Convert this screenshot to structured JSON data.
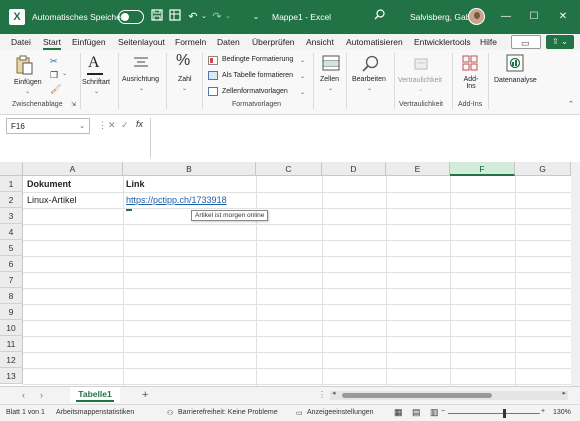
{
  "title_bar": {
    "autosave_label": "Automatisches Speichern",
    "autosave_state": "off",
    "document_title": "Mappe1  -  Excel",
    "user_name": "Salvisberg, Gaby",
    "icons": [
      "save-icon",
      "table-icon",
      "undo-icon",
      "redo-icon",
      "qat-customize-icon",
      "search-icon"
    ],
    "accent_color": "#217346"
  },
  "ribbon_tabs": [
    "Datei",
    "Start",
    "Einfügen",
    "Seitenlayout",
    "Formeln",
    "Daten",
    "Überprüfen",
    "Ansicht",
    "Automatisieren",
    "Entwicklertools",
    "Hilfe"
  ],
  "active_tab": "Start",
  "ribbon": {
    "paste_label": "Einfügen",
    "clipboard_group": "Zwischenablage",
    "font_label": "Schriftart",
    "alignment_label": "Ausrichtung",
    "number_label": "Zahl",
    "percent_symbol": "%",
    "conditional_formatting": "Bedingte Formatierung",
    "format_as_table": "Als Tabelle formatieren",
    "cell_styles": "Zellenformatvorlagen",
    "styles_group": "Formatvorlagen",
    "cells_label": "Zellen",
    "editing_label": "Bearbeiten",
    "sensitivity_label": "Vertraulichkeit",
    "sensitivity_group": "Vertraulichkeit",
    "addins_label": "Add-Ins",
    "addins_group": "Add-Ins",
    "data_analysis_label": "Datenanalyse"
  },
  "formula_bar": {
    "name_box": "F16",
    "fx_label": "fx",
    "formula": ""
  },
  "grid": {
    "columns": [
      "A",
      "B",
      "C",
      "D",
      "E",
      "F",
      "G"
    ],
    "selected_column": "F",
    "rows": [
      "1",
      "2",
      "3",
      "4",
      "5",
      "6",
      "7",
      "8",
      "9",
      "10",
      "11",
      "12",
      "13"
    ],
    "cells": {
      "A1": "Dokument",
      "B1": "Link",
      "A2": "Linux-Artikel",
      "B2": "https://pctipp.ch/1733918"
    },
    "tooltip": "Artikel ist morgen online"
  },
  "sheets": {
    "tabs": [
      "Tabelle1"
    ],
    "active": "Tabelle1"
  },
  "status_bar": {
    "sheet_position": "Blatt 1 von 1",
    "workbook_stats": "Arbeitsmappenstatistiken",
    "accessibility": "Barrierefreiheit: Keine Probleme",
    "display_settings": "Anzeigeeinstellungen",
    "zoom": "130%"
  }
}
